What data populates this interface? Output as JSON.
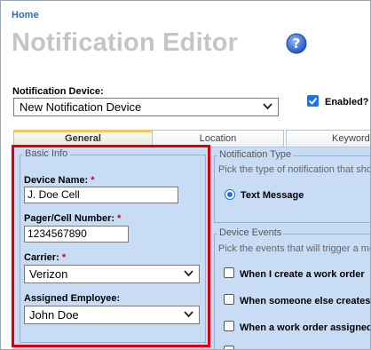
{
  "breadcrumb": {
    "home": "Home"
  },
  "page": {
    "title": "Notification Editor"
  },
  "device": {
    "label": "Notification Device:",
    "selected": "New Notification Device",
    "enabled_label": "Enabled?"
  },
  "tabs": [
    {
      "label": "General",
      "active": true
    },
    {
      "label": "Location",
      "active": false
    },
    {
      "label": "Keywords",
      "active": false
    }
  ],
  "basic_info": {
    "legend": "Basic Info",
    "device_name": {
      "label": "Device Name:",
      "required": "*",
      "value": "J. Doe Cell"
    },
    "pager": {
      "label": "Pager/Cell Number:",
      "required": "*",
      "value": "1234567890"
    },
    "carrier": {
      "label": "Carrier:",
      "required": "*",
      "value": "Verizon"
    },
    "employee": {
      "label": "Assigned Employee:",
      "value": "John Doe"
    }
  },
  "notification_type": {
    "legend": "Notification Type",
    "hint": "Pick the type of notification that sho",
    "option": "Text Message"
  },
  "device_events": {
    "legend": "Device Events",
    "hint": "Pick the events that will trigger a me",
    "options": [
      "When I create a work order",
      "When someone else creates",
      "When a work order assigned"
    ]
  },
  "colors": {
    "accent": "#1a73e8",
    "highlight": "#d7000f",
    "panel": "#c9dcf5"
  },
  "icons": [
    "help-icon",
    "chevron-down-icon",
    "checkbox-checked-icon",
    "radio-selected-icon"
  ]
}
